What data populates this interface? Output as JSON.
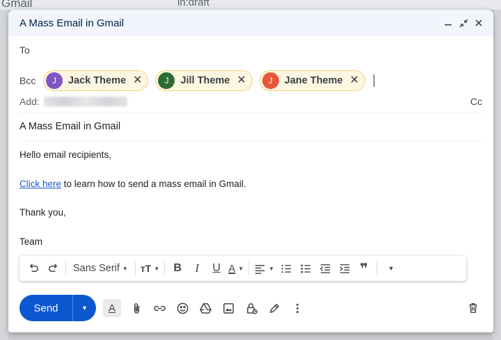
{
  "background": {
    "brand": "Gmail",
    "search_text": "in:draft"
  },
  "compose": {
    "title": "A Mass Email in Gmail",
    "to_label": "To",
    "bcc_label": "Bcc",
    "recipients": [
      {
        "initial": "J",
        "name": "Jack Theme",
        "color": "#7e57c2"
      },
      {
        "initial": "J",
        "name": "Jill Theme",
        "color": "#2e6b30"
      },
      {
        "initial": "J",
        "name": "Jane Theme",
        "color": "#e8573a"
      }
    ],
    "add_label": "Add:",
    "cc_label": "Cc",
    "subject": "A Mass Email in Gmail",
    "body": {
      "greeting": "Hello email recipients,",
      "link_text": "Click here",
      "line2_rest": " to learn how to send a mass email in Gmail.",
      "closing": "Thank you,",
      "signature": "Team"
    },
    "toolbar": {
      "font": "Sans Serif"
    },
    "send_label": "Send"
  },
  "colors": {
    "send": "#0b57d0",
    "header": "#f2f6fc",
    "chip_border": "#f3d27a",
    "link": "#1a57c7"
  }
}
